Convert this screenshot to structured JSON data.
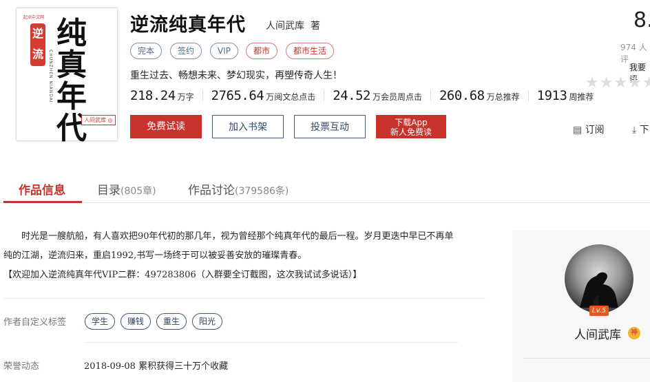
{
  "book": {
    "title": "逆流纯真年代",
    "author": "人间武库",
    "author_suffix": "著",
    "tags": [
      "完本",
      "签约",
      "VIP",
      "都市",
      "都市生活"
    ],
    "tagline": "重生过去、畅想未来、梦幻现实，再塑传奇人生！",
    "stats": [
      {
        "num": "218.24",
        "unit": "万字"
      },
      {
        "num": "2765.64",
        "unit": "万阅文总点击"
      },
      {
        "num": "24.52",
        "unit": "万会员周点击"
      },
      {
        "num": "260.68",
        "unit": "万总推荐"
      },
      {
        "num": "1913",
        "unit": "周推荐"
      }
    ],
    "score": "8.",
    "score_count": "974 人评",
    "want_rate": "我要评"
  },
  "cover": {
    "publisher": "起点中文网",
    "red_label": "逆流",
    "title_chars": "纯真年代",
    "pinyin": "CHUNZHEN NIANDAI",
    "author_badge": "人间武库 ◎"
  },
  "buttons": {
    "read": "免费试读",
    "shelf": "加入书架",
    "vote": "投票互动",
    "app_line1": "下载App",
    "app_line2": "新人免费读",
    "subscribe": "订阅",
    "download": "下"
  },
  "tabs": [
    {
      "label": "作品信息",
      "count": ""
    },
    {
      "label": "目录",
      "count": "(805章)"
    },
    {
      "label": "作品讨论",
      "count": "(379586条)"
    }
  ],
  "intro": {
    "line1": "　　时光是一艘航船，有人喜欢把90年代初的那几年，视为曾经那个纯真年代的最后一程。岁月更迭中早已不再单",
    "line2": "纯的江湖，逆流归来，重启1992,书写一场终于可以被妥善安放的璀璨青春。",
    "line3": "【欢迎加入逆流纯真年代VIP二群：497283806（入群要全订截图，这次我试试多说话）】"
  },
  "custom_tags": {
    "label": "作者自定义标签",
    "items": [
      "学生",
      "赚钱",
      "重生",
      "阳光"
    ]
  },
  "honor": {
    "label": "荣誉动态",
    "text": "2018-09-08  累积获得三十万个收藏"
  },
  "author_panel": {
    "level": "Lv.5",
    "name": "人间武库",
    "badge": "神"
  }
}
